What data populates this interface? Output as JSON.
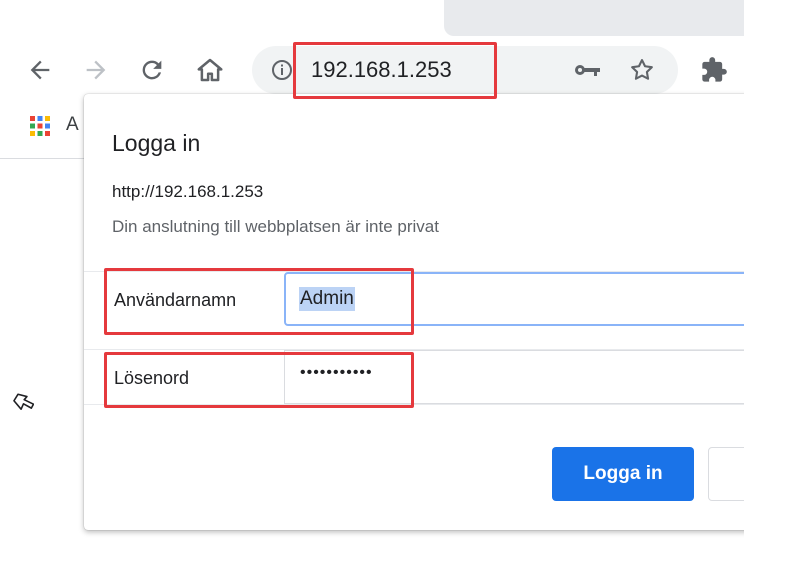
{
  "browser": {
    "address": "192.168.1.253",
    "bookmark_partial": "A",
    "icons": {
      "back": "arrow-left-icon",
      "forward": "arrow-right-icon",
      "reload": "reload-icon",
      "home": "home-icon",
      "info": "info-icon",
      "password": "key-icon",
      "bookmark": "star-icon",
      "extensions": "puzzle-icon",
      "apps": "apps-grid-icon"
    }
  },
  "dialog": {
    "title": "Logga in",
    "origin": "http://192.168.1.253",
    "warning": "Din anslutning till webbplatsen är inte privat",
    "username_label": "Användarnamn",
    "username_value": "Admin",
    "password_label": "Lösenord",
    "password_value": "•••••••••••",
    "submit_label": "Logga in"
  },
  "colors": {
    "accent": "#1a73e8",
    "highlight": "#e5393d"
  }
}
